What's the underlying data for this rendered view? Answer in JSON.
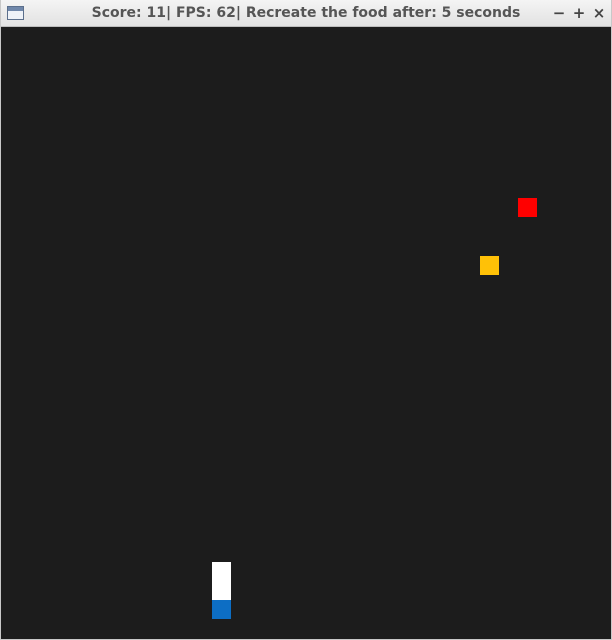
{
  "window": {
    "title": "Score: 11| FPS: 62| Recreate the food after: 5 seconds",
    "controls": {
      "minimize": "−",
      "maximize": "+",
      "close": "×"
    }
  },
  "game": {
    "score": 11,
    "fps": 62,
    "food_respawn_seconds": 5,
    "background_color": "#1c1c1c",
    "food": [
      {
        "color": "#ff0000"
      },
      {
        "color": "#ffc107"
      }
    ],
    "snake": {
      "head_color": "#0d6ec4",
      "body_color": "#ffffff"
    }
  }
}
